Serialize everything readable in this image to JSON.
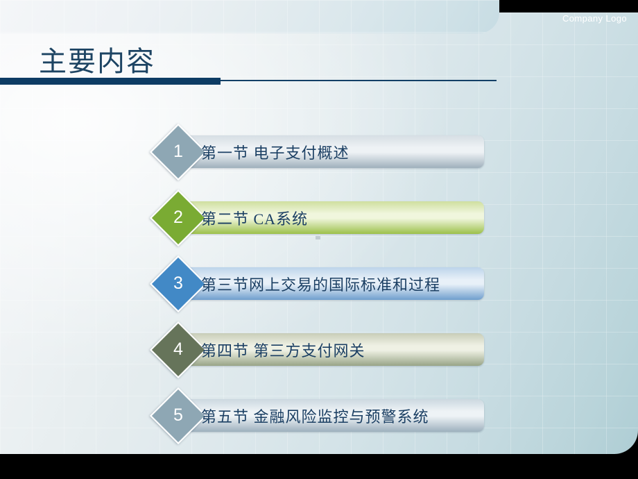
{
  "slide": {
    "company_logo": "Company Logo",
    "title": "主要内容",
    "items": [
      {
        "number": "1",
        "label": "第一节 电子支付概述",
        "diamond_color": "#8ea7b4",
        "bar_color_start": "#d6dee4",
        "bar_color_mid": "#eef2f5",
        "bar_color_end": "#9fb0bc"
      },
      {
        "number": "2",
        "label": "第二节 CA系统",
        "diamond_color": "#7aab33",
        "bar_color_start": "#cfdf9f",
        "bar_color_mid": "#f0f6dd",
        "bar_color_end": "#9cc04a"
      },
      {
        "number": "3",
        "label": "第三节网上交易的国际标准和过程",
        "diamond_color": "#4289c6",
        "bar_color_start": "#bcd4ea",
        "bar_color_mid": "#e8f0f8",
        "bar_color_end": "#6f9ecd"
      },
      {
        "number": "4",
        "label": "第四节 第三方支付网关",
        "diamond_color": "#66745a",
        "bar_color_start": "#c8cdb8",
        "bar_color_mid": "#eff1e4",
        "bar_color_end": "#98a487"
      },
      {
        "number": "5",
        "label": "第五节 金融风险监控与预警系统",
        "diamond_color": "#8ea7b4",
        "bar_color_start": "#ccd8e0",
        "bar_color_mid": "#eef3f6",
        "bar_color_end": "#9db0bd"
      }
    ],
    "accent_navy": "#0d3c64",
    "title_color": "#1d4463",
    "text_color": "#1b3f63"
  }
}
